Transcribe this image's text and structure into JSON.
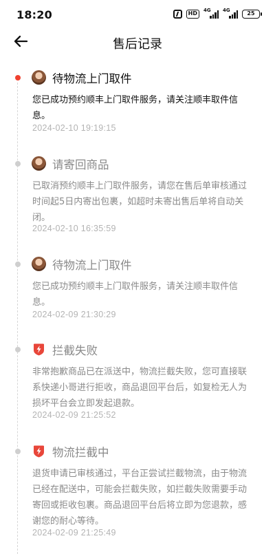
{
  "status_bar": {
    "time": "18:20",
    "network_1": "4G",
    "network_2": "4G",
    "battery": "25",
    "hd_label": "HD"
  },
  "nav": {
    "title": "售后记录",
    "back_icon": "arrow-left-icon"
  },
  "colors": {
    "active_dot": "#f0412f",
    "inactive_dot": "#cfcfcf",
    "badge": "#e8463a",
    "muted_text": "#8a8a8a",
    "timestamp": "#b3b3b3"
  },
  "records": [
    {
      "title": "待物流上门取件",
      "icon": "avatar",
      "active": true,
      "description": "您已成功预约顺丰上门取件服务，请关注顺丰取件信息。",
      "time": "2024-02-10 19:19:15"
    },
    {
      "title": "请寄回商品",
      "icon": "avatar",
      "active": false,
      "description": "已取消预约顺丰上门取件服务，请您在售后单审核通过时间起5日内寄出包裹，如超时未寄出售后单将自动关闭。",
      "time": "2024-02-10 16:35:59"
    },
    {
      "title": "待物流上门取件",
      "icon": "avatar",
      "active": false,
      "description": "您已成功预约顺丰上门取件服务，请关注顺丰取件信息。",
      "time": "2024-02-09 21:30:29"
    },
    {
      "title": "拦截失败",
      "icon": "shield-badge",
      "active": false,
      "description": "非常抱歉商品已在派送中，物流拦截失败，您可直接联系快递小哥进行拒收，商品退回平台后，如复检无人为损坏平台会立即发起退款。",
      "time": "2024-02-09 21:25:52"
    },
    {
      "title": "物流拦截中",
      "icon": "shield-badge",
      "active": false,
      "description": "退货申请已审核通过，平台正尝试拦截物流，由于物流已经在配送中，可能会拦截失败，如拦截失败需要手动寄回或拒收包裹。商品退回平台后将立即为您退款，感谢您的耐心等待。",
      "time": "2024-02-09 21:25:49"
    }
  ]
}
